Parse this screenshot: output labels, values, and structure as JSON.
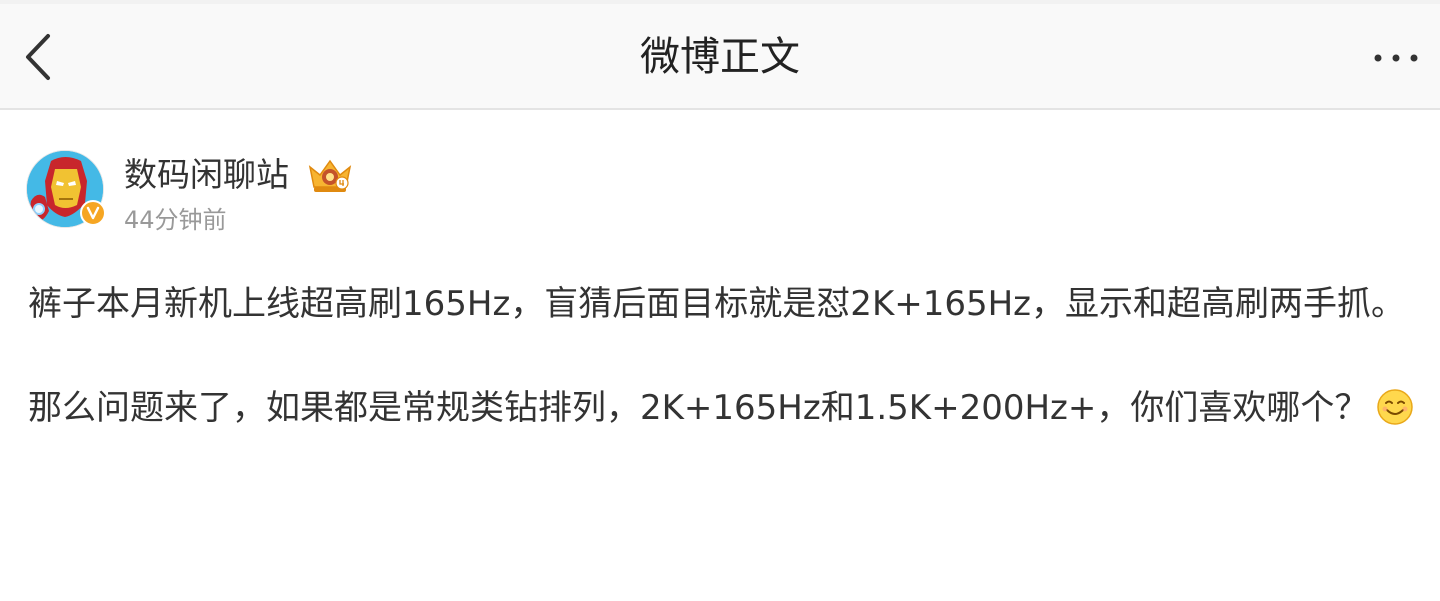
{
  "nav": {
    "title": "微博正文",
    "back_icon": "chevron-left-icon",
    "more_icon": "more-horizontal-icon"
  },
  "author": {
    "name": "数码闲聊站",
    "time": "44分钟前",
    "avatar_icon": "iron-man-avatar",
    "verified_icon": "verified-v-icon",
    "crown_icon": "crown-level-badge-icon"
  },
  "post": {
    "paragraph1": "裤子本月新机上线超高刷165Hz，盲猜后面目标就是怼2K+165Hz，显示和超高刷两手抓。",
    "paragraph2": "那么问题来了，如果都是常规类钻排列，2K+165Hz和1.5K+200Hz+，你们喜欢哪个？",
    "emoji_icon": "smile-emoji-icon"
  },
  "colors": {
    "navbar_bg": "#f9f9f9",
    "text": "#333333",
    "muted": "#999999",
    "badge_gold": "#f5a623"
  }
}
